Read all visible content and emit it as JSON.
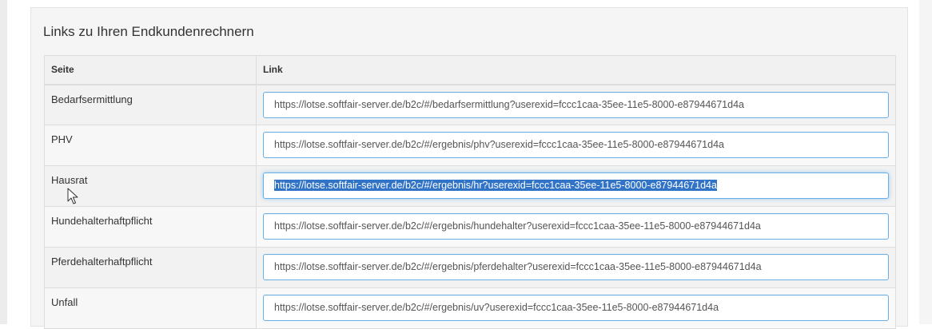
{
  "panel": {
    "title": "Links zu Ihren Endkundenrechnern"
  },
  "table": {
    "headers": {
      "page": "Seite",
      "link": "Link"
    },
    "rows": [
      {
        "page": "Bedarfsermittlung",
        "link": "https://lotse.softfair-server.de/b2c/#/bedarfsermittlung?userexid=fccc1caa-35ee-11e5-8000-e87944671d4a"
      },
      {
        "page": "PHV",
        "link": "https://lotse.softfair-server.de/b2c/#/ergebnis/phv?userexid=fccc1caa-35ee-11e5-8000-e87944671d4a"
      },
      {
        "page": "Hausrat",
        "link": "https://lotse.softfair-server.de/b2c/#/ergebnis/hr?userexid=fccc1caa-35ee-11e5-8000-e87944671d4a",
        "selected": true
      },
      {
        "page": "Hundehalterhaftpflicht",
        "link": "https://lotse.softfair-server.de/b2c/#/ergebnis/hundehalter?userexid=fccc1caa-35ee-11e5-8000-e87944671d4a"
      },
      {
        "page": "Pferdehalterhaftpflicht",
        "link": "https://lotse.softfair-server.de/b2c/#/ergebnis/pferdehalter?userexid=fccc1caa-35ee-11e5-8000-e87944671d4a"
      },
      {
        "page": "Unfall",
        "link": "https://lotse.softfair-server.de/b2c/#/ergebnis/uv?userexid=fccc1caa-35ee-11e5-8000-e87944671d4a"
      }
    ]
  },
  "colors": {
    "selection": "#3173c7",
    "input_border": "#66afe9"
  },
  "icons": {
    "cursor": "mouse-pointer-icon"
  }
}
